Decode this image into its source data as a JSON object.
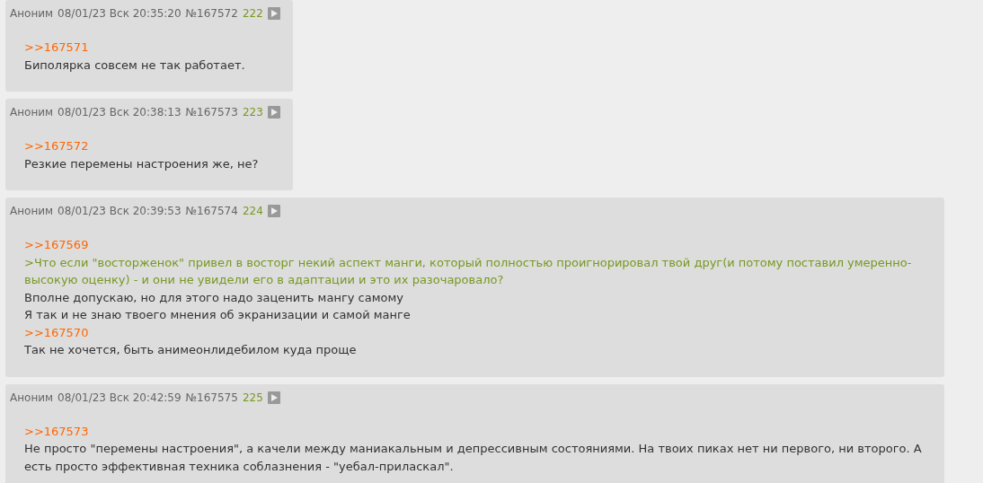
{
  "posts": [
    {
      "name": "Аноним",
      "date": "08/01/23 Вск 20:35:20",
      "number": "№167572",
      "ordinal": "222",
      "lines": [
        {
          "kind": "reply_link",
          "text": ">>167571"
        },
        {
          "kind": "text",
          "text": "Биполярка совсем не так работает."
        }
      ]
    },
    {
      "name": "Аноним",
      "date": "08/01/23 Вск 20:38:13",
      "number": "№167573",
      "ordinal": "223",
      "lines": [
        {
          "kind": "reply_link",
          "text": ">>167572"
        },
        {
          "kind": "text",
          "text": "Резкие перемены настроения же, не?"
        }
      ]
    },
    {
      "name": "Аноним",
      "date": "08/01/23 Вск 20:39:53",
      "number": "№167574",
      "ordinal": "224",
      "lines": [
        {
          "kind": "reply_link",
          "text": ">>167569"
        },
        {
          "kind": "quote",
          "text": ">Что если \"восторженок\" привел в восторг некий аспект манги, который полностью проигнорировал твой друг(и потому поставил умеренно-высокую оценку) - и они не увидели его в адаптации и это их разочаровало?"
        },
        {
          "kind": "text",
          "text": "Вполне допускаю, но для этого надо заценить мангу самому"
        },
        {
          "kind": "text",
          "text": "Я так и не знаю твоего мнения об экранизации и самой манге"
        },
        {
          "kind": "reply_link",
          "text": ">>167570"
        },
        {
          "kind": "text",
          "text": "Так не хочется, быть анимеонлидебилом куда проще"
        }
      ]
    },
    {
      "name": "Аноним",
      "date": "08/01/23 Вск 20:42:59",
      "number": "№167575",
      "ordinal": "225",
      "lines": [
        {
          "kind": "reply_link",
          "text": ">>167573"
        },
        {
          "kind": "text",
          "text": "Не просто \"перемены настроения\", а качели между маниакальным и депрессивным состояниями. На твоих пиках нет ни первого, ни второго. А есть просто эффективная техника соблазнения - \"уебал-приласкал\"."
        }
      ]
    }
  ]
}
